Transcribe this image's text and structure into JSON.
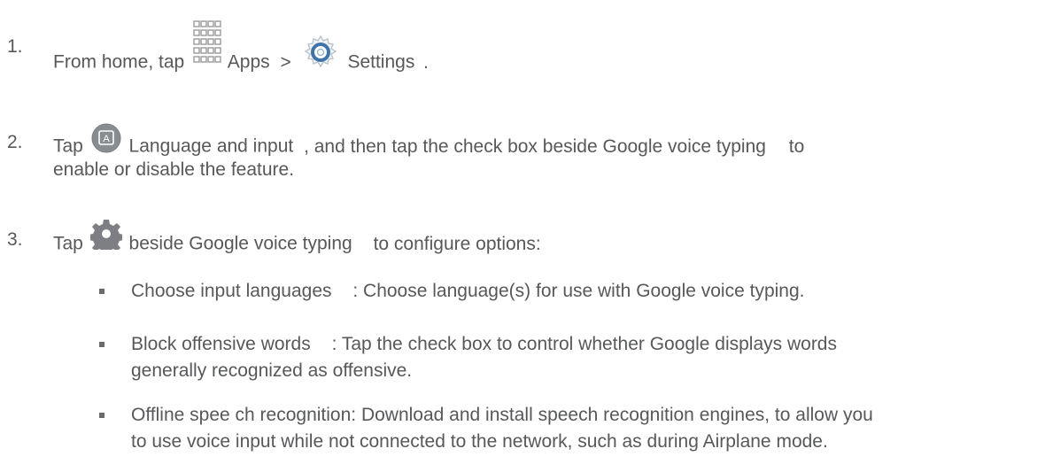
{
  "step1": {
    "number": "1.",
    "text_before_apps": "From home, tap",
    "apps_icon": "apps-grid-icon",
    "apps_label": "Apps",
    "separator": ">",
    "settings_icon": "settings-gear-icon",
    "settings_label": "Settings",
    "end": "."
  },
  "step2": {
    "number": "2.",
    "tap": "Tap",
    "icon": "language-a-icon",
    "language_label": "Language and input",
    "line1_rest": ", and then tap the check box beside Google voice typing",
    "line1_end": "to",
    "line2": "enable or disable the feature."
  },
  "step3": {
    "number": "3.",
    "tap": "Tap",
    "icon": "gear-icon",
    "rest_a": "beside Google voice typing",
    "rest_b": "to configure options:"
  },
  "options": [
    {
      "label": "Choose input languages",
      "desc_line1": ": Choose language(s) for use with Google voice typing."
    },
    {
      "label": "Block offensive words",
      "desc_line1": ": Tap the check box to control whether Google displays words",
      "desc_line2": "generally recognized as offensive."
    },
    {
      "label": "Offline spee ch recognition",
      "desc_line1": ": Download and install speech recognition engines, to allow you",
      "desc_line2": "to use voice input while not connected to the network, such as during Airplane mode."
    }
  ],
  "colors": {
    "text": "#57585a",
    "settings_icon_blue": "#3f74a8",
    "apps_grid": "#9a9a9a"
  }
}
